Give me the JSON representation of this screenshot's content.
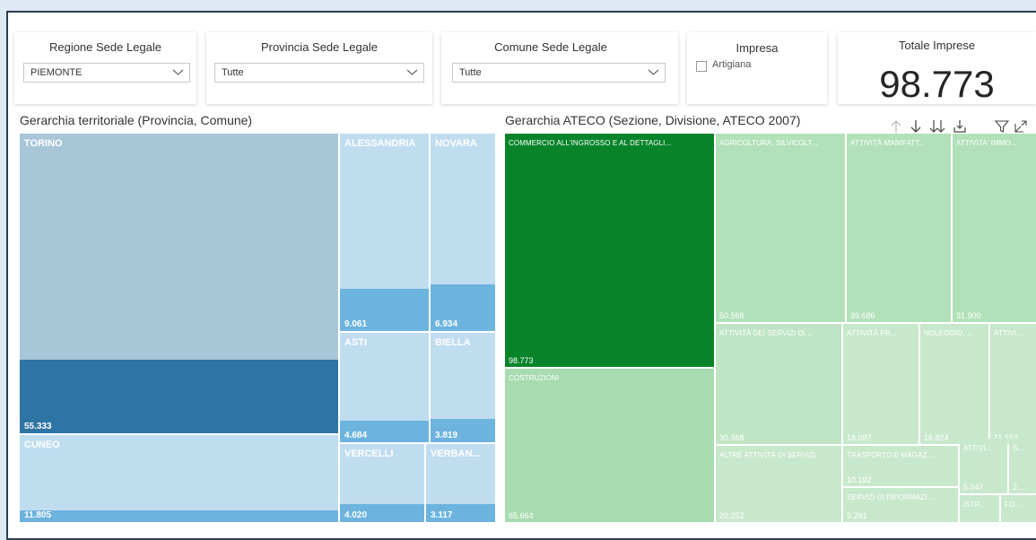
{
  "filters": {
    "regione": {
      "title": "Regione Sede Legale",
      "value": "PIEMONTE"
    },
    "provincia": {
      "title": "Provincia Sede Legale",
      "value": "Tutte"
    },
    "comune": {
      "title": "Comune Sede Legale",
      "value": "Tutte"
    },
    "impresa": {
      "title": "Impresa",
      "option": "Artigiana",
      "checked": false
    }
  },
  "kpi": {
    "title": "Totale Imprese",
    "value": "98.773"
  },
  "territorial": {
    "title": "Gerarchia territoriale (Provincia, Comune)",
    "tiles": [
      {
        "name": "TORINO",
        "value": "55.333"
      },
      {
        "name": "CUNEO",
        "value": "11.805"
      },
      {
        "name": "ALESSANDRIA",
        "value": "9.061"
      },
      {
        "name": "NOVARA",
        "value": "6.934"
      },
      {
        "name": "ASTI",
        "value": "4.684"
      },
      {
        "name": "BIELLA",
        "value": "3.819"
      },
      {
        "name": "VERCELLI",
        "value": "4.020"
      },
      {
        "name": "VERBAN...",
        "value": "3.117"
      }
    ]
  },
  "ateco": {
    "title": "Gerarchia ATECO (Sezione, Divisione, ATECO 2007)",
    "tiles": [
      {
        "name": "COMMERCIO ALL'INGROSSO E AL DETTAGLI...",
        "value": "98.773"
      },
      {
        "name": "COSTRUZIONI",
        "value": "65.664"
      },
      {
        "name": "AGRICOLTURA, SILVICOLT...",
        "value": "50.568"
      },
      {
        "name": "ATTIVITÀ MANIFATT...",
        "value": "39.686"
      },
      {
        "name": "ATTIVITA' IMMO...",
        "value": "31.900"
      },
      {
        "name": "ATTIVITÀ DEI SERVIZI DI ...",
        "value": "30.968"
      },
      {
        "name": "ATTIVITÀ PR...",
        "value": "18.097"
      },
      {
        "name": "NOLEGGIO, ...",
        "value": "16.824"
      },
      {
        "name": "ATTIVI...",
        "value": "11.153"
      },
      {
        "name": "ALTRE ATTIVITÀ DI SERVIZI",
        "value": "20.252"
      },
      {
        "name": "TRASPORTO E MAGAZ...",
        "value": "10.192"
      },
      {
        "name": "ATTIVI...",
        "value": "5.047"
      },
      {
        "name": "S...",
        "value": "2...."
      },
      {
        "name": "SERVIZI DI INFORMAZI...",
        "value": "9.291"
      },
      {
        "name": "ISTR...",
        "value": ""
      },
      {
        "name": "FO...",
        "value": ""
      }
    ]
  },
  "colors": {
    "torino": "#2e75a3",
    "torino_parent": "#a9c6d8",
    "prov_dark": "#6cb3de",
    "prov_light": "#c0ddf0",
    "commercio": "#07842a",
    "green_mid": "#a8dbb0",
    "green_light": "#c8e8cc"
  },
  "toolbar": {
    "icons": [
      "drill-up-icon",
      "drill-down-icon",
      "expand-all-icon",
      "expand-level-icon",
      "filter-icon",
      "focus-mode-icon"
    ]
  }
}
